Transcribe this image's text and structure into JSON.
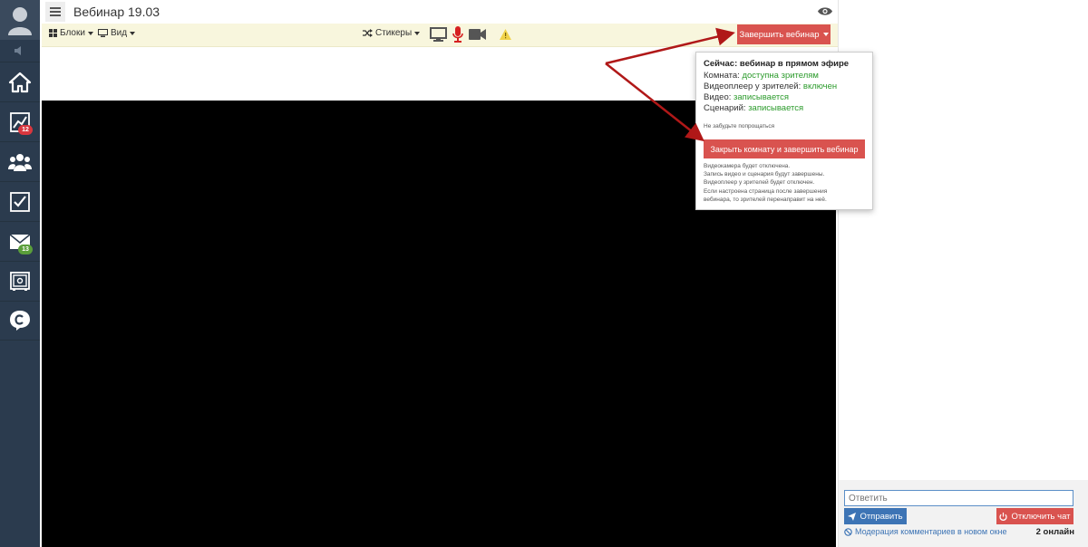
{
  "sidebar": {
    "items": [
      {
        "icon": "home-icon"
      },
      {
        "icon": "chart-icon",
        "badge": "12",
        "badge_color": "#d9363e"
      },
      {
        "icon": "users-icon"
      },
      {
        "icon": "checklist-icon"
      },
      {
        "icon": "mail-icon",
        "badge": "13",
        "badge_color": "#5a9e3a"
      },
      {
        "icon": "safe-icon"
      },
      {
        "icon": "chat-icon"
      }
    ]
  },
  "header": {
    "title": "Вебинар 19.03"
  },
  "toolbar": {
    "blocks_label": "Блоки",
    "view_label": "Вид",
    "stickers_label": "Стикеры",
    "end_webinar_label": "Завершить вебинар"
  },
  "popup": {
    "title": "Сейчас: вебинар в прямом эфире",
    "room_label": "Комната:",
    "room_value": "доступна зрителям",
    "player_label": "Видеоплеер у зрителей:",
    "player_value": "включен",
    "video_label": "Видео:",
    "video_value": "записывается",
    "scenario_label": "Сценарий:",
    "scenario_value": "записывается",
    "note": "Не забудьте попрощаться",
    "close_button": "Закрыть комнату и завершить вебинар",
    "desc_1": "Видеокамера будет отключена.",
    "desc_2": "Запись видео и сценария будут завершены.",
    "desc_3": "Видеоплеер у зрителей будет отключен.",
    "desc_4": "Если настроена страница после завершения",
    "desc_5": "вебинара, то зрителей перенаправит на неё."
  },
  "chat": {
    "reply_placeholder": "Ответить",
    "send_label": "Отправить",
    "disable_chat_label": "Отключить чат",
    "moderation_link": "Модерация комментариев в новом окне",
    "online": "2 онлайн"
  },
  "colors": {
    "sidebar": "#2b3b4e",
    "toolbar": "#f8f6dd",
    "danger": "#d9534f",
    "primary": "#3d74b5",
    "status_green": "#2c9b2c",
    "arrow": "#b01818"
  }
}
